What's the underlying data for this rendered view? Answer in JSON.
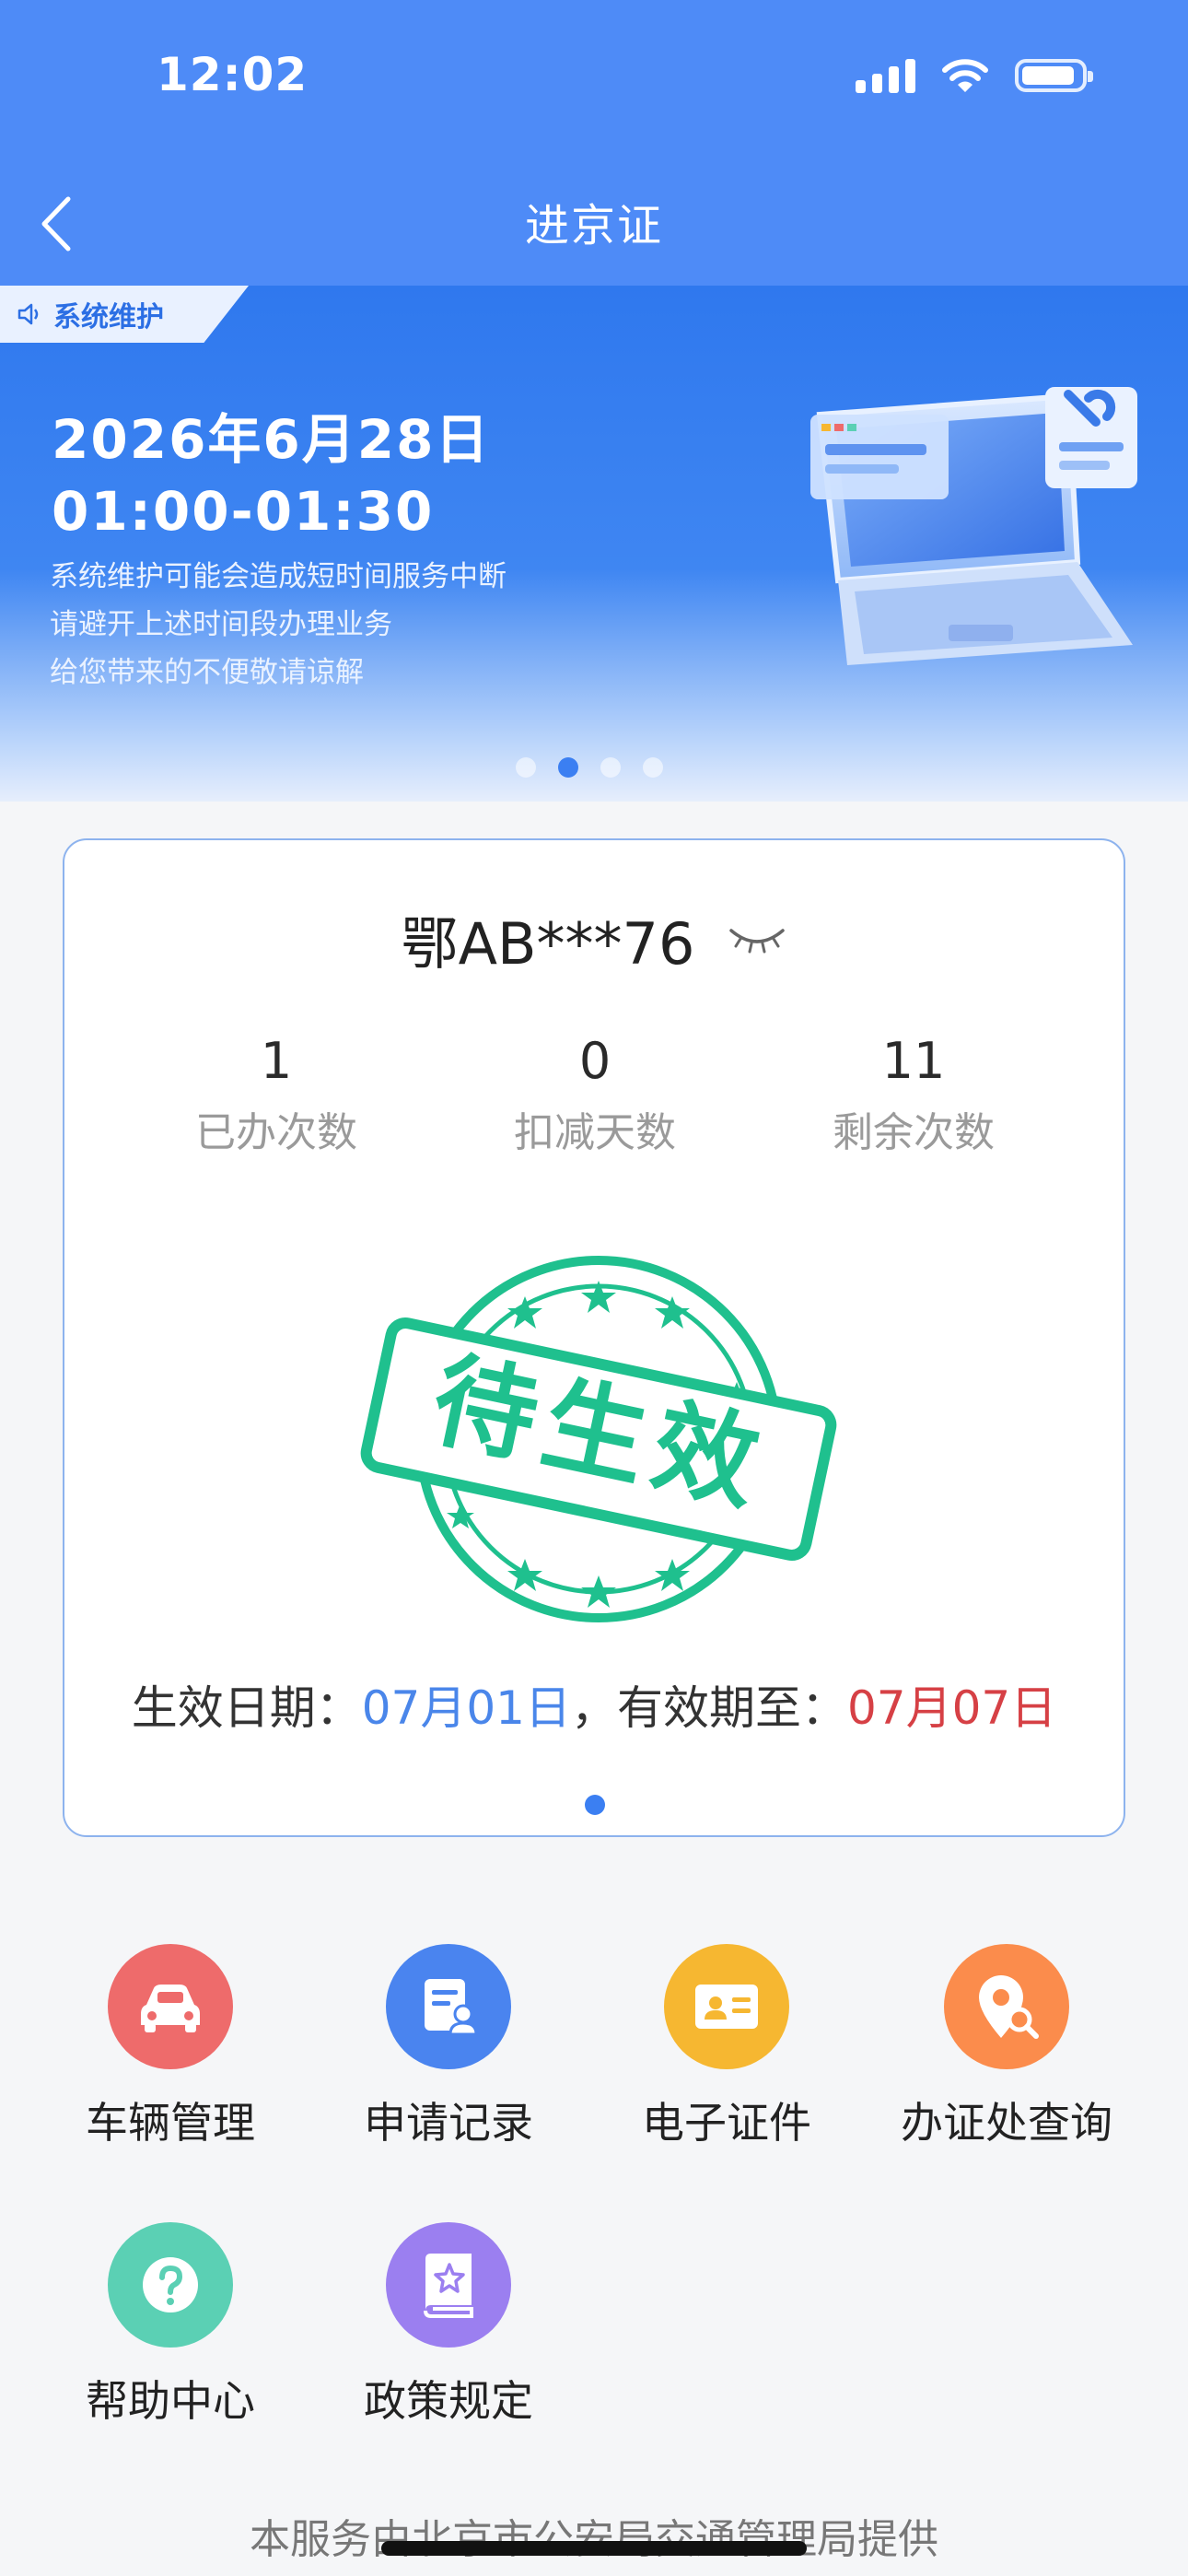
{
  "status_bar": {
    "time": "12:02"
  },
  "nav": {
    "title": "进京证"
  },
  "banner": {
    "tag": "系统维护",
    "date_line1": "2026年6月28日",
    "date_line2": "01:00-01:30",
    "lines": [
      "系统维护可能会造成短时间服务中断",
      "请避开上述时间段办理业务",
      "给您带来的不便敬请谅解"
    ],
    "dots": 4,
    "active_dot": 2
  },
  "permit": {
    "plate": "鄂AB***76",
    "stats": [
      {
        "value": "1",
        "label": "已办次数"
      },
      {
        "value": "0",
        "label": "扣减天数"
      },
      {
        "value": "11",
        "label": "剩余次数"
      }
    ],
    "stamp_text": "待生效",
    "effective_label": "生效日期：",
    "effective_date": "07月01日",
    "separator": "，",
    "valid_until_label": "有效期至：",
    "valid_until_date": "07月07日"
  },
  "services": [
    {
      "label": "车辆管理",
      "icon": "car-icon",
      "color": "#ee6b6b"
    },
    {
      "label": "申请记录",
      "icon": "record-icon",
      "color": "#4a84ef"
    },
    {
      "label": "电子证件",
      "icon": "id-card-icon",
      "color": "#f6b731"
    },
    {
      "label": "办证处查询",
      "icon": "location-search-icon",
      "color": "#fb8c4c"
    },
    {
      "label": "帮助中心",
      "icon": "help-icon",
      "color": "#5bd0b4"
    },
    {
      "label": "政策规定",
      "icon": "policy-book-icon",
      "color": "#9b7ff0"
    }
  ],
  "footer": {
    "text": "本服务由北京市公安局交通管理局提供"
  },
  "colors": {
    "header": "#4e8bf7",
    "accent_blue": "#4a86ea",
    "accent_red": "#d64045",
    "stamp_green": "#1fc08e"
  }
}
